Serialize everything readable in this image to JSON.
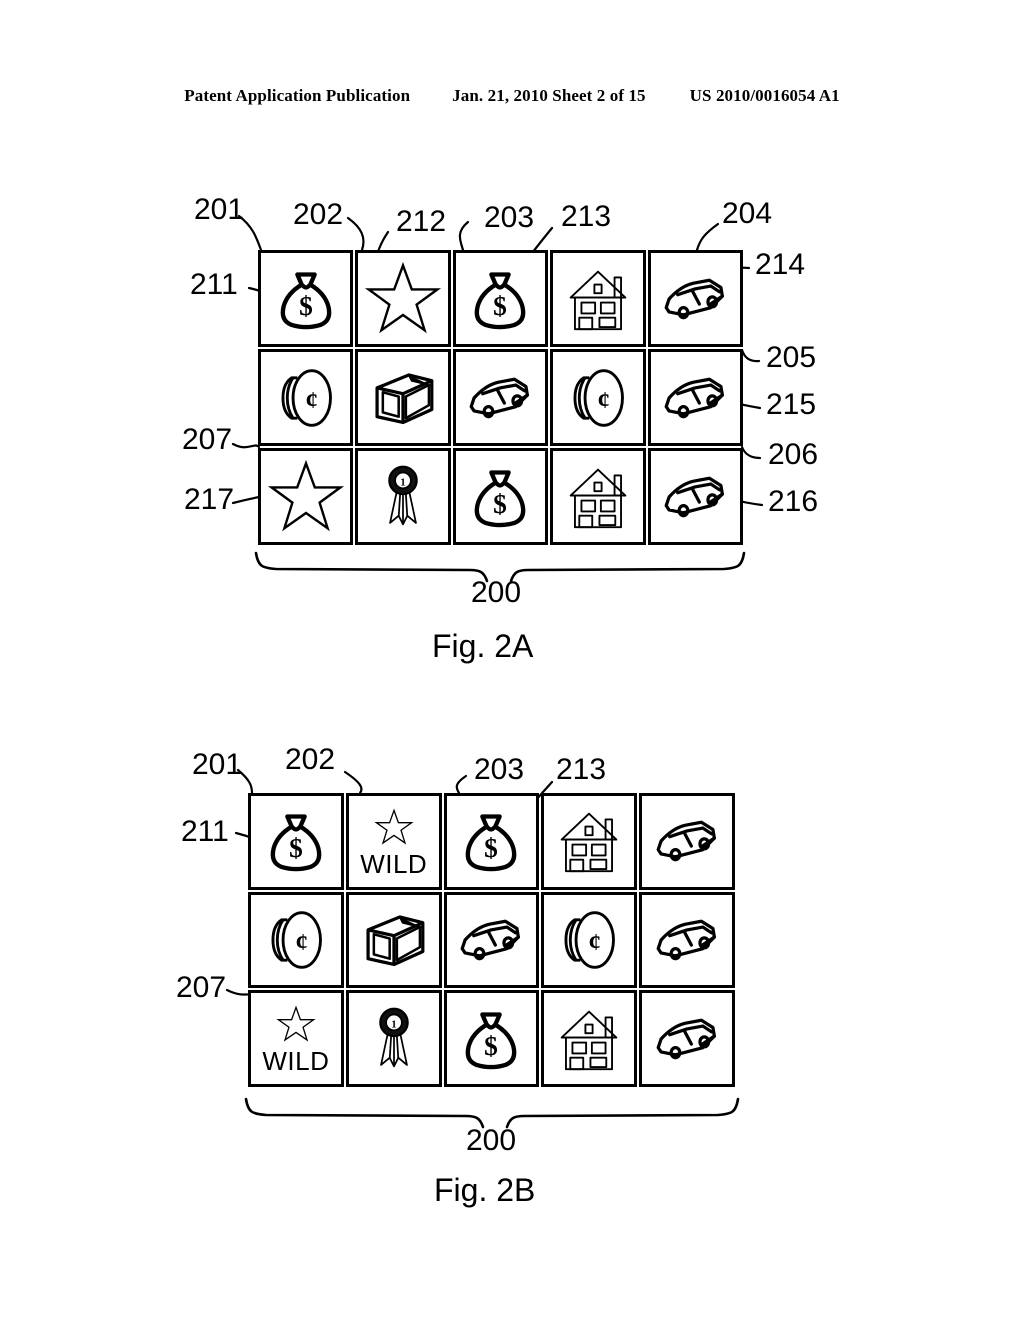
{
  "header": {
    "publication": "Patent Application Publication",
    "date_sheet": "Jan. 21, 2010  Sheet 2 of 15",
    "patent_number": "US 2010/0016054 A1"
  },
  "figures": [
    {
      "id": "fig-2a",
      "caption": "Fig. 2A",
      "brace_label": "200",
      "top_refs": [
        "201",
        "202",
        "212",
        "203",
        "213",
        "204"
      ],
      "left_refs": [
        "211",
        "207",
        "217"
      ],
      "right_refs": [
        "214",
        "205",
        "215",
        "206",
        "216"
      ],
      "reels": [
        [
          "money-bag",
          "star",
          "money-bag",
          "house",
          "car"
        ],
        [
          "coin",
          "television",
          "car",
          "coin",
          "car"
        ],
        [
          "star",
          "ribbon",
          "money-bag",
          "house",
          "car"
        ]
      ],
      "wild_label": ""
    },
    {
      "id": "fig-2b",
      "caption": "Fig. 2B",
      "brace_label": "200",
      "top_refs": [
        "201",
        "202",
        "203",
        "213"
      ],
      "left_refs": [
        "211",
        "207"
      ],
      "right_refs": [],
      "reels": [
        [
          "money-bag",
          "star-wild",
          "money-bag",
          "house",
          "car"
        ],
        [
          "coin",
          "television",
          "car",
          "coin",
          "car"
        ],
        [
          "star-wild",
          "ribbon",
          "money-bag",
          "house",
          "car"
        ]
      ],
      "wild_label": "WILD"
    }
  ],
  "symbols": {
    "money-bag": "money-bag-symbol",
    "star": "star-symbol",
    "star-wild": "wild-star-symbol",
    "house": "house-symbol",
    "car": "car-symbol",
    "coin": "coin-symbol",
    "television": "television-symbol",
    "ribbon": "award-ribbon-symbol"
  },
  "colors": {
    "ink": "#000000",
    "paper": "#ffffff"
  }
}
